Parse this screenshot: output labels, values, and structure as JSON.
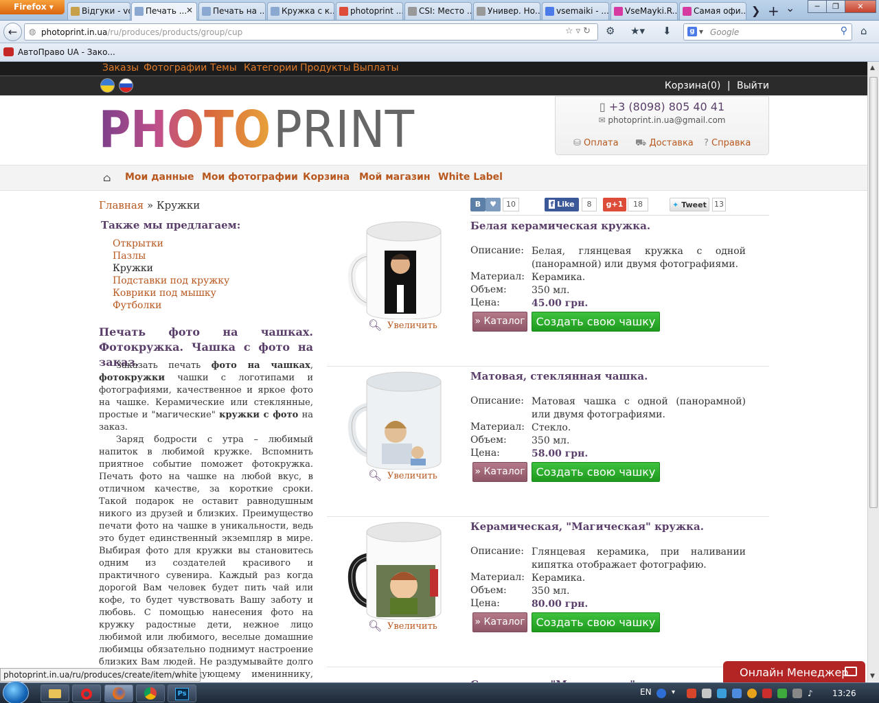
{
  "browser": {
    "app_button": "Firefox",
    "tabs": [
      {
        "label": "Відгуки - vov...",
        "fav": "#c9a04a"
      },
      {
        "label": "Печать ...",
        "fav": "#8aa8d0",
        "active": true
      },
      {
        "label": "Печать на ...",
        "fav": "#8aa8d0"
      },
      {
        "label": "Кружка с к...",
        "fav": "#8aa8d0"
      },
      {
        "label": "photoprint ...",
        "fav": "#dd4b39"
      },
      {
        "label": "CSI: Место ...",
        "fav": "#999999"
      },
      {
        "label": "Универ. Но...",
        "fav": "#999999"
      },
      {
        "label": "vsemaiki - ...",
        "fav": "#4a7be8"
      },
      {
        "label": "VseMayki.R...",
        "fav": "#d63aa0"
      },
      {
        "label": "Самая офи...",
        "fav": "#d63aa0"
      }
    ],
    "tab_close": "✕",
    "new_tab": "+",
    "tab_scroll_right": "❯",
    "tab_list": "⌄",
    "window_buttons": [
      "─",
      "❐",
      "✕"
    ],
    "url_host": "photoprint.in.ua",
    "url_path": "/ru/produces/products/group/cup",
    "search_placeholder": "Google",
    "bookmark": "АвтоПраво UA - Зако...",
    "status_url": "photoprint.in.ua/ru/produces/create/item/white"
  },
  "site": {
    "top_nav": [
      "Заказы",
      "Фотографии",
      "Темы",
      "Категории",
      "Продукты",
      "Выплаты"
    ],
    "cart_link": "Корзина(0)",
    "separator": "|",
    "logout": "Выйти",
    "logo_left": "PHOTO",
    "logo_right": "PRINT",
    "phone": "+3 (8098) 805 40 41",
    "email": "photoprint.in.ua@gmail.com",
    "contact_links": [
      "Оплата",
      "Доставка",
      "Справка"
    ],
    "main_menu": [
      "Мои данные",
      "Мои фотографии",
      "Корзина",
      "Мой магазин",
      "White Label"
    ],
    "breadcrumb": {
      "home": "Главная",
      "sep": " » ",
      "current": "Кружки"
    },
    "social": {
      "vk_label": "В",
      "vk_count": "10",
      "fb_label": "Like",
      "fb_count": "8",
      "gplus_label": "+1",
      "gplus_count": "18",
      "tw_label": "Tweet",
      "tw_count": "13"
    },
    "also_title": "Также мы предлагаем:",
    "also_items": [
      "Открытки",
      "Пазлы",
      "Кружки",
      "Подставки под кружку",
      "Коврики под мышку",
      "Футболки"
    ],
    "seo_title": "Печать фото на чашках. Фотокружка. Чашка с фото на заказ.",
    "seo_p1_a": "Заказать печать ",
    "seo_p1_b": "фото на чашках",
    "seo_p1_c": ", ",
    "seo_p1_d": "фотокружки",
    "seo_p1_e": " чашки с логотипами и фотографиями, качественное и яркое фото на чашке. Керамические или стеклянные, простые и \"магические\" ",
    "seo_p1_f": "кружки с фото",
    "seo_p1_g": " на заказ.",
    "seo_p2": "Заряд бодрости с утра – любимый напиток в любимой кружке. Вспомнить приятное событие поможет фотокружка. Печать фото на чашке на любой вкус, в отличном качестве, за короткие сроки. Такой подарок не оставит равнодушным никого из друзей и близких. Преимущество печати фото на чашке в уникальности, ведь это будет единственный экземпляр в мире. Выбирая фото для кружки вы становитесь одним из создателей красивого и практичного сувенира. Каждый раз когда дорогой Вам человек будет пить чай или кофе, то будет чувствовать Вашу заботу и любовь. С помощью нанесения фото на кружку радостные дети, нежное лицо любимой или любимого, веселые домашние любимцы обязательно поднимут настроение близких Вам людей. Не раздумывайте долго что подарить следующему имениннику, выбирайте лучшее фото и заказывайте чашку.",
    "labels": {
      "desc": "Описание:",
      "material": "Материал:",
      "volume": "Объем:",
      "price": "Цена:"
    },
    "zoom_label": "Увеличить",
    "catalog_btn": "» Каталог",
    "create_btn": "Создать свою чашку",
    "products": [
      {
        "title": "Белая керамическая кружка.",
        "desc": "Белая, глянцевая кружка с одной (панорамной) или двумя фотографиями.",
        "material": "Керамика.",
        "volume": "350 мл.",
        "price": "45.00 грн.",
        "mug": "white"
      },
      {
        "title": "Матовая, стеклянная чашка.",
        "desc": "Матовая чашка с одной (панорамной) или двумя фотографиями.",
        "material": "Стекло.",
        "volume": "350 мл.",
        "price": "58.00 грн.",
        "mug": "glass"
      },
      {
        "title": "Керамическая, \"Магическая\" кружка.",
        "desc": "Глянцевая керамика, при наливании кипятка отображает фотографию.",
        "material": "Керамика.",
        "volume": "350 мл.",
        "price": "80.00 грн.",
        "mug": "magic"
      }
    ],
    "next_product_title": "Стеклянная, \"Магическая\" ...",
    "online_manager": "Онлайн Менеджер"
  },
  "taskbar": {
    "apps": [
      "explorer",
      "opera",
      "firefox",
      "chrome",
      "photoshop"
    ],
    "photoshop_label": "Ps",
    "lang": "EN",
    "clock": "13:26"
  }
}
